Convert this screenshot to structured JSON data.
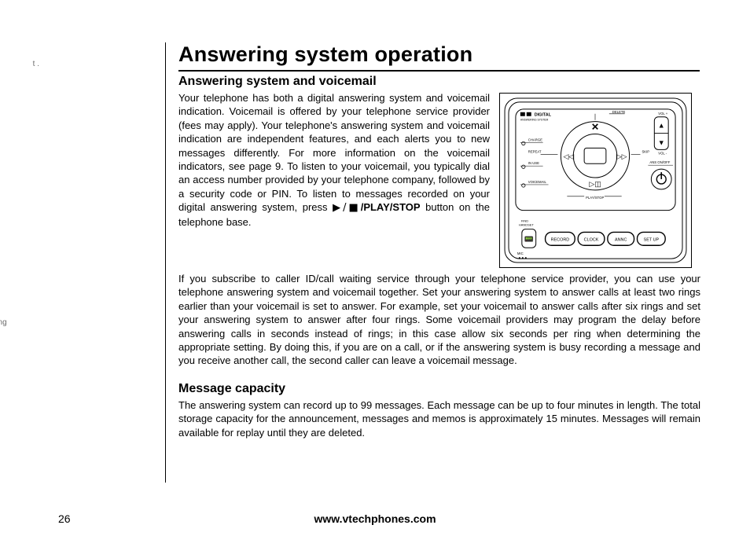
{
  "gutter": {
    "frag1": "t\n.",
    "frag2": "ring",
    "frag3": ")."
  },
  "title": "Answering system operation",
  "section1": {
    "heading": "Answering system and voicemail",
    "p1_before": "Your telephone has both a digital answering system and voicemail indication.  Voicemail is offered by your telephone service provider (fees may apply). Your telephone's answering system and voicemail indication are independent features, and each alerts you to new messages differently. For more information on the voicemail indicators, see page 9. To listen to your voicemail, you typically dial an access number provided by your telephone company, followed by a security code or PIN. To listen to messages recorded on your digital answering system, press ",
    "p1_bold": "/PLAY/STOP",
    "p1_after": " button on the telephone base.",
    "p2": "If you subscribe to caller ID/call waiting service through your telephone service provider, you can use your telephone answering system and voicemail together. Set your answering system to answer calls at least two rings earlier than your voicemail is set to answer. For example, set your voicemail to answer calls after six rings and set your answering system to answer after four rings. Some voicemail providers may program the delay before answering calls in seconds instead of rings; in this case allow six seconds per ring when determining the appropriate setting. By doing this, if you are on a call, or if the answering system is busy recording a message and you receive another call, the second caller can leave a voicemail message."
  },
  "section2": {
    "heading": "Message capacity",
    "p1": "The answering system can record up to 99 messages. Each message can be up to four minutes in length. The total storage capacity for the announcement, messages and memos is approximately 15 minutes. Messages will remain available for replay until they are deleted."
  },
  "diagram": {
    "labels": {
      "brand": "DIGITAL",
      "brand_sub": "ANSWERING SYSTEM",
      "delete": "DELETE",
      "vol_up": "VOL +",
      "vol_down": "VOL -",
      "repeat": "REPEAT",
      "skip": "SKIP",
      "play_stop": "PLAY/STOP",
      "charge": "CHARGE",
      "in_use": "IN USE",
      "voicemail": "VOICEMAIL",
      "ans_on_off": "ANS ON/OFF",
      "find_handset": "FIND\nHANDSET",
      "record": "RECORD",
      "clock": "CLOCK",
      "annc": "ANNC",
      "setup": "SET UP",
      "mic": "MIC"
    }
  },
  "footer": {
    "page": "26",
    "url": "www.vtechphones.com"
  }
}
